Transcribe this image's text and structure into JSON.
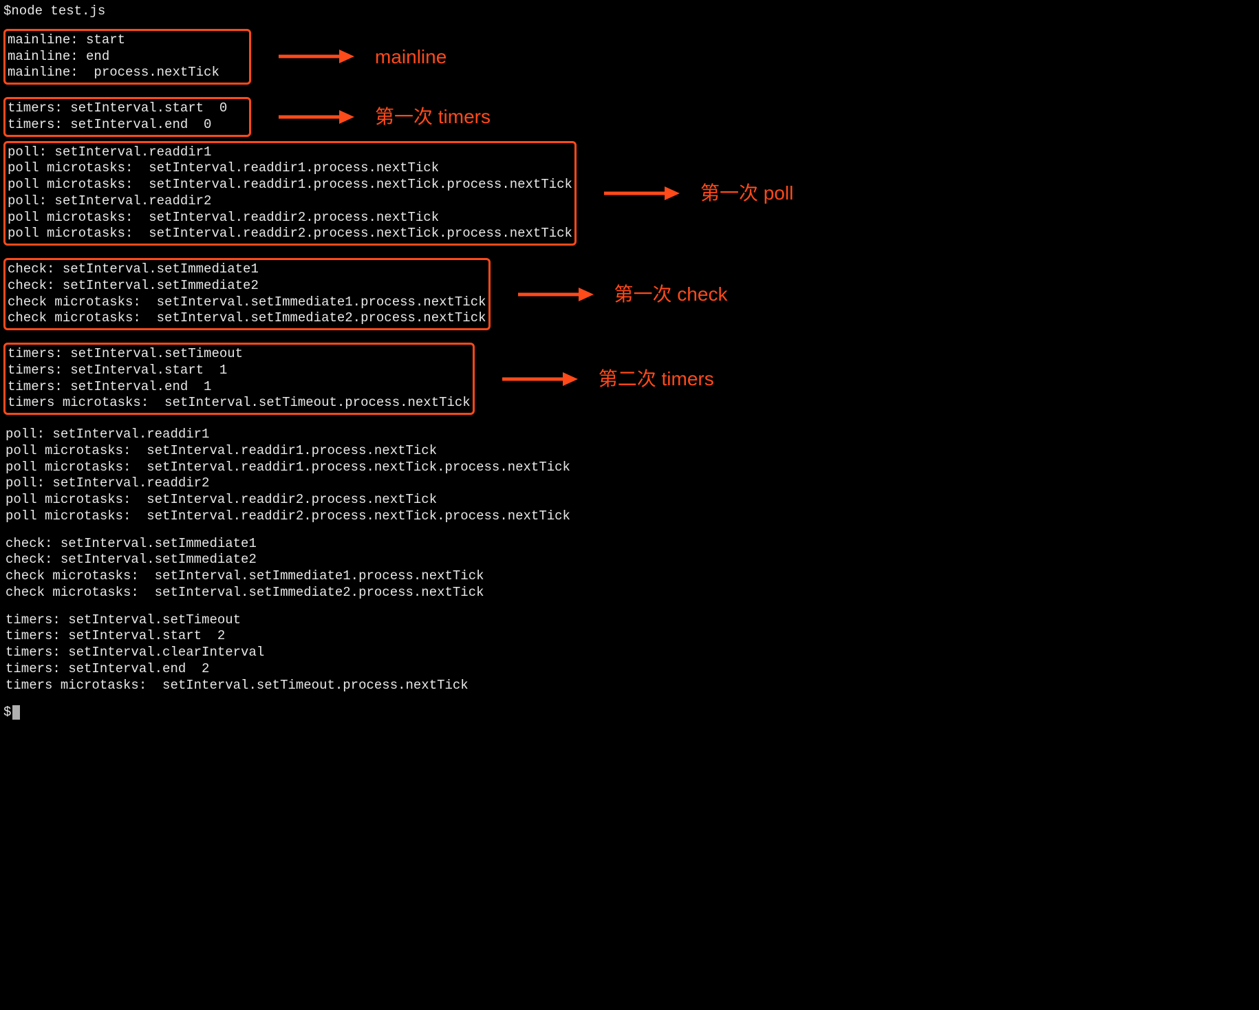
{
  "command": "$node test.js",
  "prompt": "$",
  "colors": {
    "accent": "#ff4a1a",
    "background": "#000000",
    "foreground": "#ffffff"
  },
  "sections": [
    {
      "id": "mainline",
      "label": "mainline",
      "boxed": true,
      "lines": [
        "mainline: start",
        "mainline: end",
        "mainline:  process.nextTick"
      ]
    },
    {
      "id": "timers1",
      "label": "第一次 timers",
      "boxed": true,
      "lines": [
        "timers: setInterval.start  0",
        "timers: setInterval.end  0"
      ]
    },
    {
      "id": "poll1",
      "label": "第一次 poll",
      "boxed": true,
      "lines": [
        "poll: setInterval.readdir1",
        "poll microtasks:  setInterval.readdir1.process.nextTick",
        "poll microtasks:  setInterval.readdir1.process.nextTick.process.nextTick",
        "poll: setInterval.readdir2",
        "poll microtasks:  setInterval.readdir2.process.nextTick",
        "poll microtasks:  setInterval.readdir2.process.nextTick.process.nextTick"
      ]
    },
    {
      "id": "check1",
      "label": "第一次 check",
      "boxed": true,
      "lines": [
        "check: setInterval.setImmediate1",
        "check: setInterval.setImmediate2",
        "check microtasks:  setInterval.setImmediate1.process.nextTick",
        "check microtasks:  setInterval.setImmediate2.process.nextTick"
      ]
    },
    {
      "id": "timers2",
      "label": "第二次 timers",
      "boxed": true,
      "lines": [
        "timers: setInterval.setTimeout",
        "timers: setInterval.start  1",
        "timers: setInterval.end  1",
        "timers microtasks:  setInterval.setTimeout.process.nextTick"
      ]
    },
    {
      "id": "poll2",
      "label": "",
      "boxed": false,
      "lines": [
        "poll: setInterval.readdir1",
        "poll microtasks:  setInterval.readdir1.process.nextTick",
        "poll microtasks:  setInterval.readdir1.process.nextTick.process.nextTick",
        "poll: setInterval.readdir2",
        "poll microtasks:  setInterval.readdir2.process.nextTick",
        "poll microtasks:  setInterval.readdir2.process.nextTick.process.nextTick"
      ]
    },
    {
      "id": "check2",
      "label": "",
      "boxed": false,
      "lines": [
        "check: setInterval.setImmediate1",
        "check: setInterval.setImmediate2",
        "check microtasks:  setInterval.setImmediate1.process.nextTick",
        "check microtasks:  setInterval.setImmediate2.process.nextTick"
      ]
    },
    {
      "id": "timers3",
      "label": "",
      "boxed": false,
      "lines": [
        "timers: setInterval.setTimeout",
        "timers: setInterval.start  2",
        "timers: setInterval.clearInterval",
        "timers: setInterval.end  2",
        "timers microtasks:  setInterval.setTimeout.process.nextTick"
      ]
    }
  ]
}
